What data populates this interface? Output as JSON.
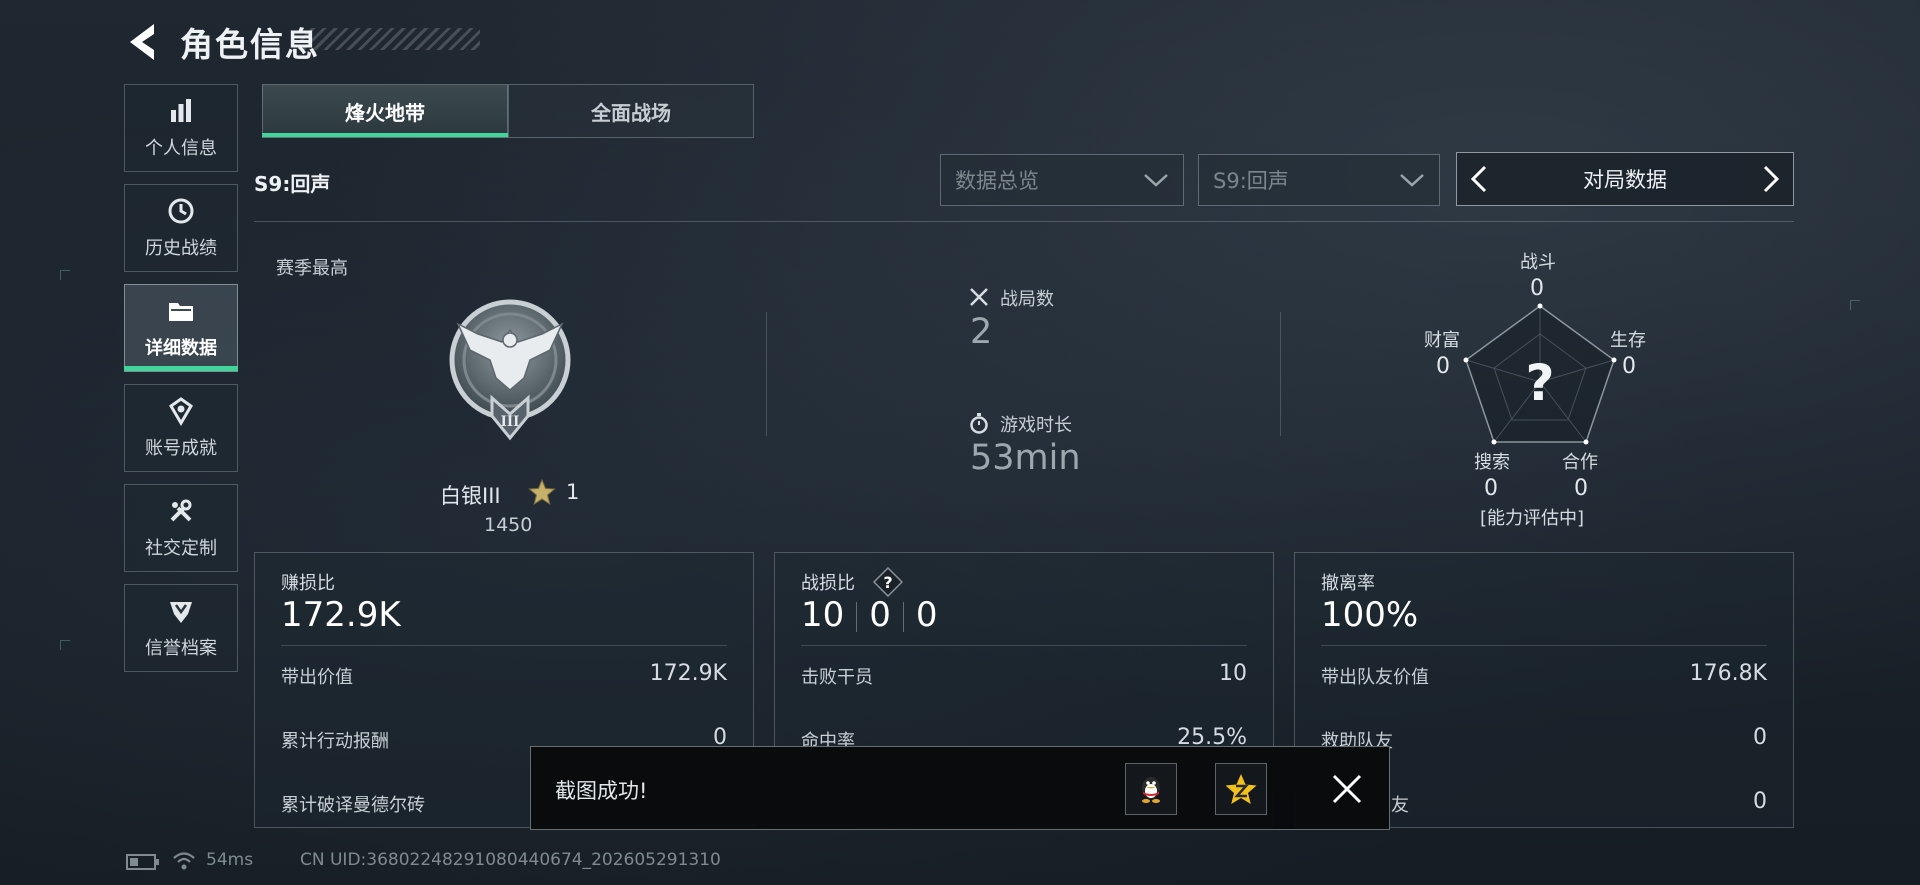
{
  "header": {
    "title": "角色信息"
  },
  "sidebar": {
    "items": [
      {
        "label": "个人信息",
        "icon": "bar-chart-icon"
      },
      {
        "label": "历史战绩",
        "icon": "clock-icon"
      },
      {
        "label": "详细数据",
        "icon": "folder-icon",
        "active": true
      },
      {
        "label": "账号成就",
        "icon": "medal-icon"
      },
      {
        "label": "社交定制",
        "icon": "wrench-icon"
      },
      {
        "label": "信誉档案",
        "icon": "shield-icon"
      }
    ]
  },
  "tabs": [
    {
      "label": "烽火地带",
      "active": true
    },
    {
      "label": "全面战场",
      "active": false
    }
  ],
  "season_label": "S9:回声",
  "filters": {
    "overview": "数据总览",
    "season": "S9:回声",
    "nav_label": "对局数据"
  },
  "rank": {
    "section_label": "赛季最高",
    "name": "白银III",
    "stars": "1",
    "score": "1450",
    "emblem_numeral": "III"
  },
  "middle_stats": {
    "matches_label": "战局数",
    "matches_value": "2",
    "playtime_label": "游戏时长",
    "playtime_value": "53min"
  },
  "radar": {
    "center_symbol": "?",
    "status": "[能力评估中]",
    "axes": [
      {
        "label": "战斗",
        "value": "0"
      },
      {
        "label": "生存",
        "value": "0"
      },
      {
        "label": "合作",
        "value": "0"
      },
      {
        "label": "搜索",
        "value": "0"
      },
      {
        "label": "财富",
        "value": "0"
      }
    ]
  },
  "cards": {
    "profit": {
      "title": "赚损比",
      "main": "172.9K",
      "rows": [
        {
          "label": "带出价值",
          "value": "172.9K"
        },
        {
          "label": "累计行动报酬",
          "value": "0"
        },
        {
          "label": "累计破译曼德尔砖",
          "value": ""
        }
      ]
    },
    "combat": {
      "title": "战损比",
      "badge": "?",
      "main": [
        "10",
        "0",
        "0"
      ],
      "rows": [
        {
          "label": "击败干员",
          "value": "10"
        },
        {
          "label": "命中率",
          "value": "25.5%"
        }
      ]
    },
    "extract": {
      "title": "撤离率",
      "main": "100%",
      "rows": [
        {
          "label": "带出队友价值",
          "value": "176.8K"
        },
        {
          "label": "救助队友",
          "value": "0"
        },
        {
          "label": "友",
          "value": "0"
        }
      ]
    }
  },
  "toast": {
    "text": "截图成功!"
  },
  "footer": {
    "ping": "54ms",
    "uid": "CN UID:3680224829108044067​4_202605291310"
  },
  "colors": {
    "accent": "#3fd59b",
    "background": "#1a222b"
  }
}
